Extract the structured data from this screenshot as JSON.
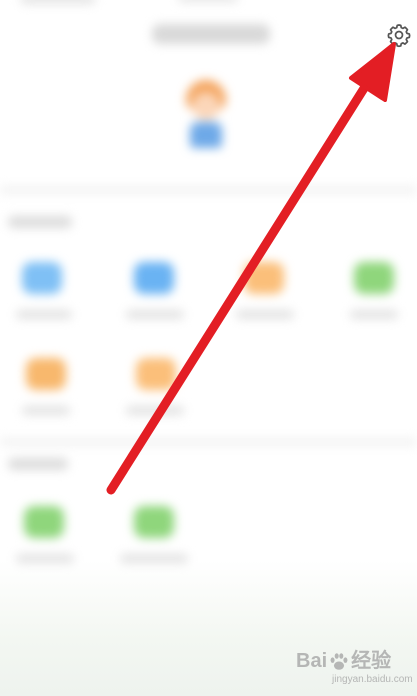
{
  "settings": {
    "icon": "gear-icon"
  },
  "annotation": {
    "arrow_color": "#e31e24"
  },
  "watermark": {
    "brand_left": "Bai",
    "brand_right": "经验",
    "url": "jingyan.baidu.com"
  },
  "colors": {
    "blue": "#7fc0f5",
    "orange": "#fbbf7a",
    "green": "#8fd67c"
  }
}
